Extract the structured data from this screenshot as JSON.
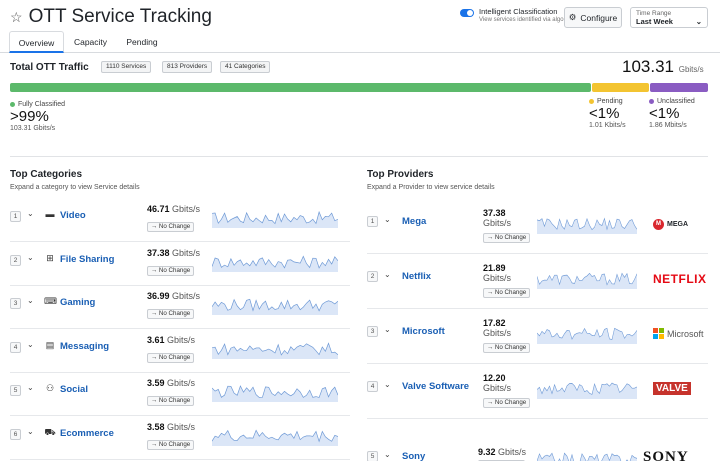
{
  "header": {
    "title": "OTT Service Tracking",
    "toggle_label": "Intelligent Classification",
    "toggle_sub": "View services identified via algorithmic matching",
    "configure_label": "Configure",
    "time_range_label": "Time Range",
    "time_range_value": "Last Week"
  },
  "tabs": [
    {
      "label": "Overview"
    },
    {
      "label": "Capacity"
    },
    {
      "label": "Pending"
    }
  ],
  "total": {
    "title": "Total OTT Traffic",
    "chips": [
      "1110 Services",
      "813 Providers",
      "41 Categories"
    ],
    "value": "103.31",
    "unit": "Gbits/s",
    "bar_fractions": {
      "classified": 0.834,
      "pending": 0.083,
      "unclassified": 0.083
    },
    "classified": {
      "label": "Fully Classified",
      "pct": ">99%",
      "rate": "103.31 Gbits/s",
      "color": "#5cb96b"
    },
    "pending": {
      "label": "Pending",
      "pct": "<1%",
      "rate": "1.01 Kbits/s",
      "color": "#f3c431"
    },
    "unclassified": {
      "label": "Unclassified",
      "pct": "<1%",
      "rate": "1.86 Mbits/s",
      "color": "#8a5cc2"
    }
  },
  "categories": {
    "title": "Top Categories",
    "subtitle": "Expand a category to view Service details",
    "items": [
      {
        "rank": "1",
        "name": "Video",
        "icon": "video-icon",
        "value": "46.71",
        "unit": "Gbits/s",
        "change": "→ No Change"
      },
      {
        "rank": "2",
        "name": "File Sharing",
        "icon": "file-sharing-icon",
        "value": "37.38",
        "unit": "Gbits/s",
        "change": "→ No Change"
      },
      {
        "rank": "3",
        "name": "Gaming",
        "icon": "gamepad-icon",
        "value": "36.99",
        "unit": "Gbits/s",
        "change": "→ No Change"
      },
      {
        "rank": "4",
        "name": "Messaging",
        "icon": "chat-icon",
        "value": "3.61",
        "unit": "Gbits/s",
        "change": "→ No Change"
      },
      {
        "rank": "5",
        "name": "Social",
        "icon": "people-icon",
        "value": "3.59",
        "unit": "Gbits/s",
        "change": "→ No Change"
      },
      {
        "rank": "6",
        "name": "Ecommerce",
        "icon": "cart-icon",
        "value": "3.58",
        "unit": "Gbits/s",
        "change": "→ No Change"
      }
    ]
  },
  "providers": {
    "title": "Top Providers",
    "subtitle": "Expand a Provider to view service details",
    "items": [
      {
        "rank": "1",
        "name": "Mega",
        "value": "37.38",
        "unit": "Gbits/s",
        "change": "→ No Change",
        "logo": "MEGA"
      },
      {
        "rank": "2",
        "name": "Netflix",
        "value": "21.89",
        "unit": "Gbits/s",
        "change": "→ No Change",
        "logo": "NETFLIX"
      },
      {
        "rank": "3",
        "name": "Microsoft",
        "value": "17.82",
        "unit": "Gbits/s",
        "change": "→ No Change",
        "logo": "Microsoft"
      },
      {
        "rank": "4",
        "name": "Valve Software",
        "value": "12.20",
        "unit": "Gbits/s",
        "change": "→ No Change",
        "logo": "VALVE"
      },
      {
        "rank": "5",
        "name": "Sony",
        "value": "9.32",
        "unit": "Gbits/s",
        "change": "→ No Change",
        "logo": "SONY"
      }
    ]
  },
  "colors": {
    "accent": "#1a73e8",
    "link": "#1a5fb4",
    "spark_fill": "#dbe6f7",
    "spark_line": "#6f9ad6"
  }
}
